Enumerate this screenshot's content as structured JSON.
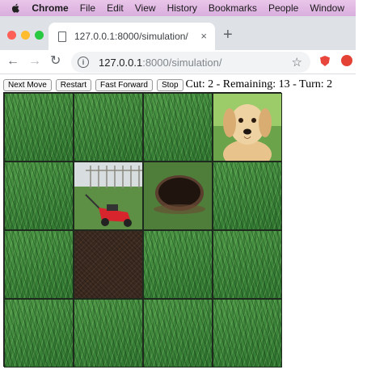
{
  "menubar": {
    "app_name": "Chrome",
    "items": [
      "File",
      "Edit",
      "View",
      "History",
      "Bookmarks",
      "People"
    ],
    "overflow_item": "Window"
  },
  "tab": {
    "title": "127.0.0.1:8000/simulation/",
    "close_glyph": "×"
  },
  "toolbar": {
    "back_glyph": "←",
    "forward_glyph": "→",
    "reload_glyph": "↻",
    "url_host": "127.0.0.1",
    "url_path": ":8000/simulation/",
    "info_glyph": "i",
    "star_glyph": "☆",
    "new_tab_glyph": "+"
  },
  "controls": {
    "next_move": "Next Move",
    "restart": "Restart",
    "fast_forward": "Fast Forward",
    "stop": "Stop"
  },
  "status": "Cut: 2 - Remaining: 13 - Turn: 2",
  "grid": {
    "rows": 4,
    "cols": 4,
    "cells": [
      [
        "grass",
        "grass",
        "grass",
        "dog"
      ],
      [
        "grass",
        "mower",
        "hole",
        "grass"
      ],
      [
        "grass",
        "dirt",
        "grass",
        "grass"
      ],
      [
        "grass",
        "grass",
        "grass",
        "grass"
      ]
    ]
  },
  "colors": {
    "menubar": "#e2bce4",
    "accent_red": "#e8453c",
    "grass": "#3f8a3a",
    "dirt": "#3a2a20"
  }
}
